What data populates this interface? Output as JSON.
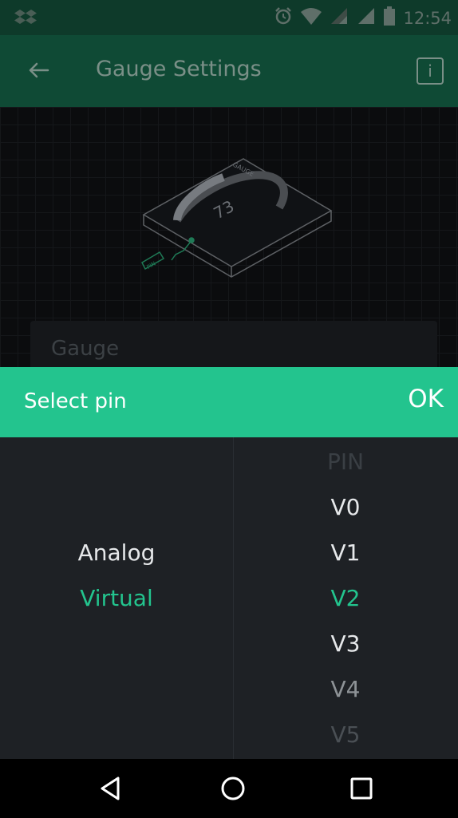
{
  "status_bar": {
    "time": "12:54",
    "icons": [
      "dropbox-icon",
      "alarm-icon",
      "wifi-icon",
      "signal-icon",
      "signal-icon",
      "battery-icon"
    ]
  },
  "app_bar": {
    "title": "Gauge Settings",
    "info_label": "i"
  },
  "illustration": {
    "gauge_label": "GAUGE",
    "gauge_value": "73",
    "pin_label": "PIN"
  },
  "name_field": {
    "value": "Gauge"
  },
  "dialog": {
    "title": "Select pin",
    "ok_label": "OK",
    "pin_types": [
      {
        "label": "Analog",
        "selected": false
      },
      {
        "label": "Virtual",
        "selected": true
      }
    ],
    "pins": [
      {
        "label": "PIN",
        "state": "header"
      },
      {
        "label": "V0",
        "state": "normal"
      },
      {
        "label": "V1",
        "state": "normal"
      },
      {
        "label": "V2",
        "state": "selected"
      },
      {
        "label": "V3",
        "state": "normal"
      },
      {
        "label": "V4",
        "state": "fade"
      },
      {
        "label": "V5",
        "state": "fade2"
      }
    ]
  },
  "colors": {
    "accent": "#23c48e",
    "status_bar": "#0e3a2a",
    "app_bar": "#0f4a35",
    "dialog_body": "#1e2125",
    "text_light": "#e6e8ea"
  },
  "nav_bar": {
    "icons": [
      "back-triangle-icon",
      "home-circle-icon",
      "recents-square-icon"
    ]
  }
}
